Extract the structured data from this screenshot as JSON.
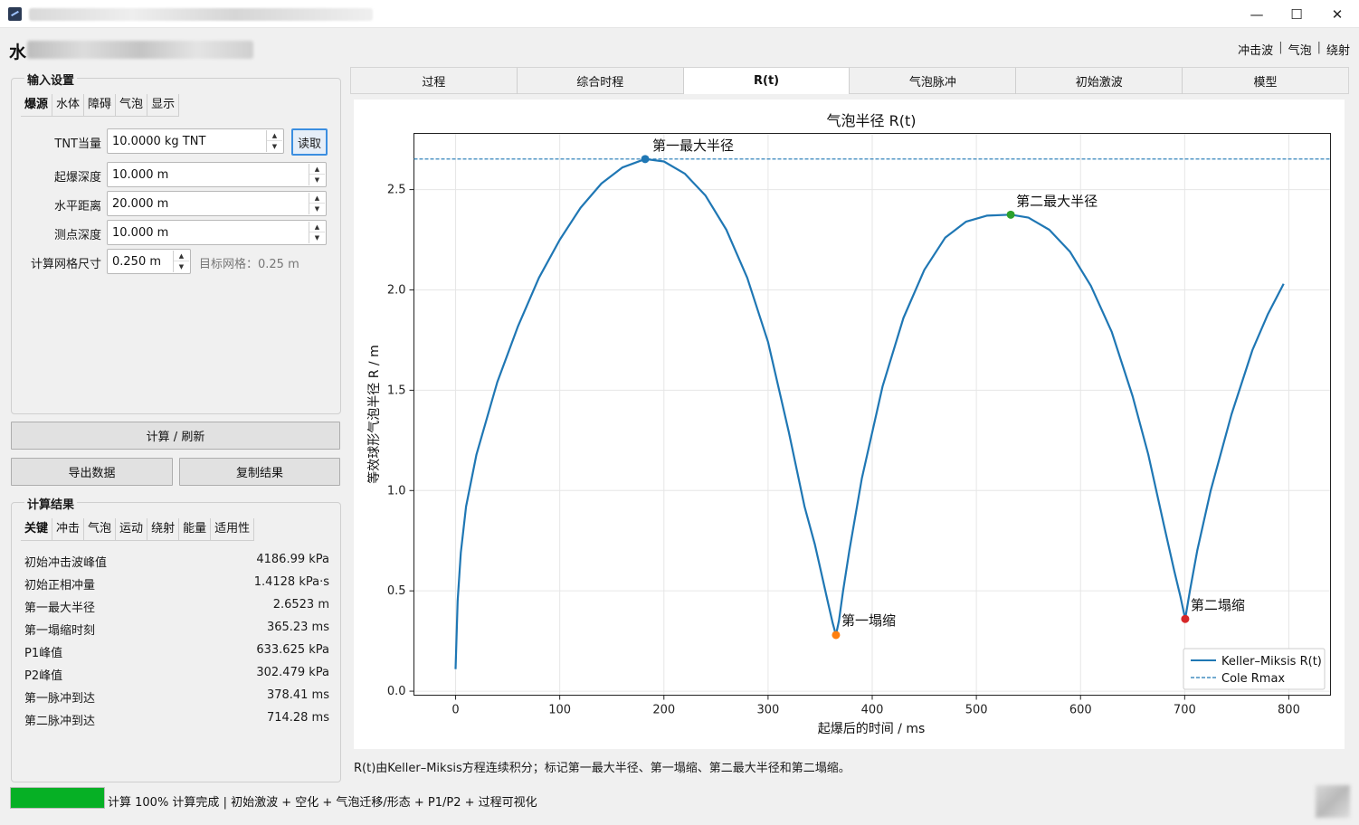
{
  "window": {
    "controls": {
      "minimize": "—",
      "maximize": "☐",
      "close": "✕"
    }
  },
  "header": {
    "title_first_char": "水",
    "nav": [
      "冲击波",
      "气泡",
      "绕射"
    ],
    "nav_separator": "|"
  },
  "input_settings": {
    "title": "输入设置",
    "tabs": [
      "爆源",
      "水体",
      "障碍",
      "气泡",
      "显示"
    ],
    "active_tab": "爆源",
    "fields": {
      "tnt": {
        "label": "TNT当量",
        "value": "10.0000 kg TNT"
      },
      "depth": {
        "label": "起爆深度",
        "value": "10.000 m"
      },
      "distance": {
        "label": "水平距离",
        "value": "20.000 m"
      },
      "gauge_depth": {
        "label": "测点深度",
        "value": "10.000 m"
      },
      "grid_size": {
        "label": "计算网格尺寸",
        "value": "0.250 m",
        "hint": "目标网格：0.25 m"
      }
    },
    "read_button": "读取"
  },
  "actions": {
    "compute": "计算 / 刷新",
    "export": "导出数据",
    "copy": "复制结果"
  },
  "results": {
    "title": "计算结果",
    "tabs": [
      "关键",
      "冲击",
      "气泡",
      "运动",
      "绕射",
      "能量",
      "适用性"
    ],
    "active_tab": "关键",
    "rows": [
      {
        "key": "初始冲击波峰值",
        "value": "4186.99 kPa"
      },
      {
        "key": "初始正相冲量",
        "value": "1.4128 kPa·s"
      },
      {
        "key": "第一最大半径",
        "value": "2.6523 m"
      },
      {
        "key": "第一塌缩时刻",
        "value": "365.23 ms"
      },
      {
        "key": "P1峰值",
        "value": "633.625 kPa"
      },
      {
        "key": "P2峰值",
        "value": "302.479 kPa"
      },
      {
        "key": "第一脉冲到达",
        "value": "378.41 ms"
      },
      {
        "key": "第二脉冲到达",
        "value": "714.28 ms"
      }
    ]
  },
  "main_tabs": [
    "过程",
    "综合时程",
    "R(t)",
    "气泡脉冲",
    "初始激波",
    "模型"
  ],
  "main_active_tab": "R(t)",
  "chart_data": {
    "type": "line",
    "title": "气泡半径 R(t)",
    "xlabel": "起爆后的时间 / ms",
    "ylabel": "等效球形气泡半径 R / m",
    "xlim": [
      -40,
      840
    ],
    "ylim": [
      -0.02,
      2.78
    ],
    "xticks": [
      0,
      100,
      200,
      300,
      400,
      500,
      600,
      700,
      800
    ],
    "yticks": [
      0.0,
      0.5,
      1.0,
      1.5,
      2.0,
      2.5
    ],
    "grid": true,
    "legend_position": "bottom-right",
    "series": [
      {
        "name": "Keller–Miksis R(t)",
        "color": "#1f77b4",
        "style": "solid",
        "x": [
          0,
          2,
          5,
          10,
          20,
          40,
          60,
          80,
          100,
          120,
          140,
          160,
          182,
          200,
          220,
          240,
          260,
          280,
          300,
          320,
          335,
          345,
          352,
          358,
          362,
          365.2,
          368,
          372,
          378,
          390,
          410,
          430,
          450,
          470,
          490,
          510,
          533,
          550,
          570,
          590,
          610,
          630,
          650,
          665,
          680,
          690,
          696,
          700.5,
          705,
          712,
          725,
          745,
          765,
          780,
          795
        ],
        "y": [
          0.11,
          0.45,
          0.69,
          0.92,
          1.18,
          1.54,
          1.82,
          2.06,
          2.25,
          2.41,
          2.53,
          2.61,
          2.6523,
          2.64,
          2.58,
          2.47,
          2.3,
          2.06,
          1.74,
          1.29,
          0.92,
          0.73,
          0.57,
          0.43,
          0.34,
          0.28,
          0.35,
          0.5,
          0.7,
          1.06,
          1.52,
          1.86,
          2.1,
          2.26,
          2.34,
          2.37,
          2.375,
          2.36,
          2.3,
          2.19,
          2.02,
          1.79,
          1.47,
          1.18,
          0.83,
          0.6,
          0.47,
          0.36,
          0.5,
          0.7,
          1.0,
          1.38,
          1.7,
          1.88,
          2.03
        ]
      },
      {
        "name": "Cole Rmax",
        "color": "#1f77b4",
        "style": "dashed",
        "y_const": 2.6523
      }
    ],
    "markers": [
      {
        "label": "第一最大半径",
        "x": 182,
        "y": 2.6523,
        "color": "#1f77b4"
      },
      {
        "label": "第一塌缩",
        "x": 365.2,
        "y": 0.28,
        "color": "#ff7f0e"
      },
      {
        "label": "第二最大半径",
        "x": 533,
        "y": 2.375,
        "color": "#2ca02c"
      },
      {
        "label": "第二塌缩",
        "x": 700.5,
        "y": 0.36,
        "color": "#d62728"
      }
    ]
  },
  "caption": "R(t)由Keller–Miksis方程连续积分；标记第一最大半径、第一塌缩、第二最大半径和第二塌缩。",
  "status": {
    "progress": 1.0,
    "text": "计算 100%  计算完成 | 初始激波 + 空化 + 气泡迁移/形态 + P1/P2 + 过程可视化",
    "progress_color": "#06b025"
  }
}
